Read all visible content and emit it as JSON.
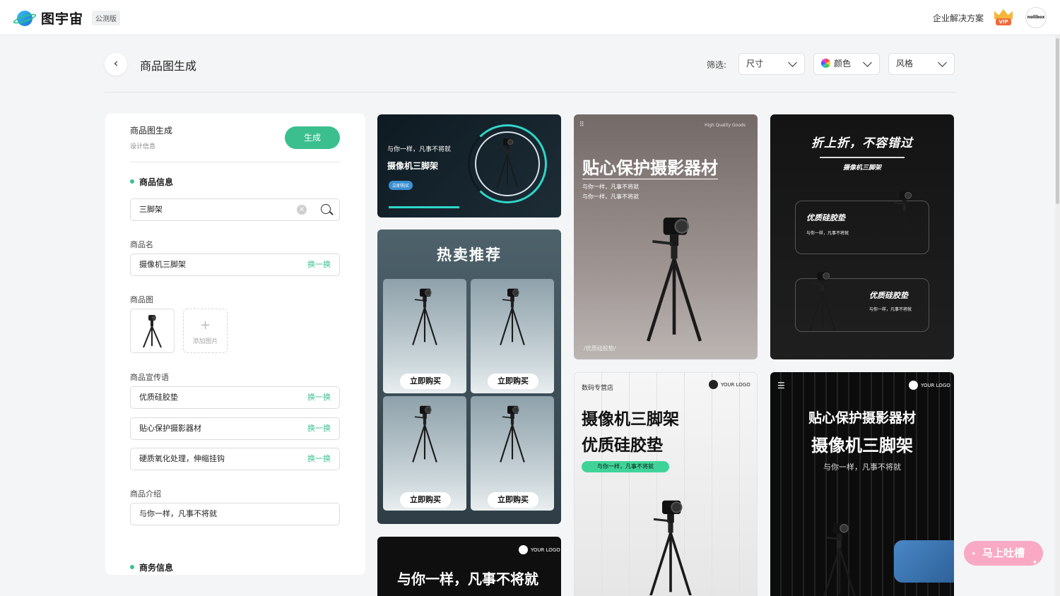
{
  "header": {
    "logo_text": "图宇宙",
    "beta_badge": "公测版",
    "enterprise_link": "企业解决方案",
    "vip_label": "VIP",
    "avatar_text": "nolibox"
  },
  "page": {
    "title": "商品图生成",
    "filter_label": "筛选:",
    "filters": [
      {
        "label": "尺寸"
      },
      {
        "label": "颜色"
      },
      {
        "label": "风格"
      }
    ]
  },
  "panel": {
    "title": "商品图生成",
    "subtitle": "设计信息",
    "generate_button": "生成",
    "product_section": "商品信息",
    "search_value": "三脚架",
    "name_label": "商品名",
    "name_value": "摄像机三脚架",
    "swap_label": "换一换",
    "image_label": "商品图",
    "add_image": "添加图片",
    "slogan_label": "商品宣传语",
    "slogans": [
      "优质硅胶垫",
      "贴心保护摄影器材",
      "硬质氧化处理，伸缩挂钩"
    ],
    "intro_label": "商品介绍",
    "intro_value": "与你一样，凡事不将就",
    "business_section": "商务信息"
  },
  "cards": {
    "c1": {
      "line1": "与你一样，凡事不将就",
      "title": "摄像机三脚架",
      "button": "立即购买"
    },
    "c2": {
      "title": "热卖推荐",
      "button": "立即购买"
    },
    "c3": {
      "tag": "High Quality Goods",
      "title": "贴心保护摄影器材",
      "line1": "与你一样，凡事不将就",
      "line2": "与你一样，凡事不将就",
      "footer": "/优质硅胶垫/"
    },
    "c4": {
      "title": "折上折，不容错过",
      "subtitle": "摄像机三脚架",
      "box1_title": "优质硅胶垫",
      "box1_text": "与你一样，凡事不将就",
      "box2_title": "优质硅胶垫",
      "box2_text": "与你一样，凡事不将就"
    },
    "c5": {
      "line1": "与你一样，凡事不将就",
      "logo": "YOUR LOGO"
    },
    "c6": {
      "store": "数码专营店",
      "logo": "YOUR LOGO",
      "title1": "摄像机三脚架",
      "title2": "优质硅胶垫",
      "pill": "与你一样，凡事不将就"
    },
    "c7": {
      "logo": "YOUR LOGO",
      "title1": "贴心保护摄影器材",
      "title2": "摄像机三脚架",
      "line1": "与你一样，凡事不将就"
    }
  },
  "feedback_button": "马上吐槽",
  "colors": {
    "accent": "#3bbf8e",
    "feedback": "#f9a9c3"
  }
}
